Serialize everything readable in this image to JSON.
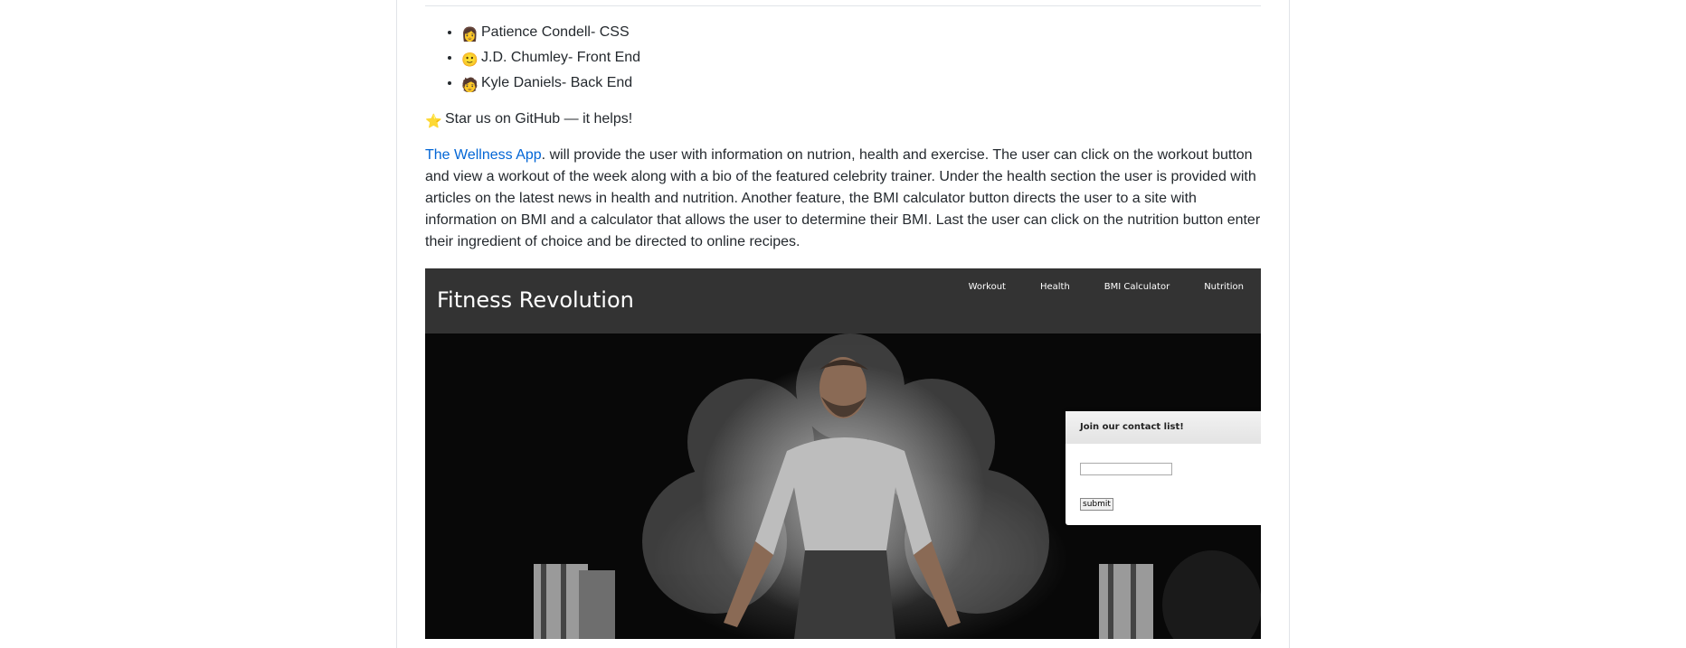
{
  "contributors": [
    {
      "icon": "woman-technologist-icon",
      "glyph": "👩",
      "name": "Patience Condell- CSS"
    },
    {
      "icon": "smiling-face-icon",
      "glyph": "🙂",
      "name": "J.D. Chumley- Front End"
    },
    {
      "icon": "technologist-icon",
      "glyph": "🧑",
      "name": "Kyle Daniels- Back End"
    }
  ],
  "star": {
    "icon": "star-icon",
    "glyph": "⭐",
    "text": "Star us on GitHub — it helps!"
  },
  "description": {
    "link_text": "The Wellness App",
    "body": ". will provide the user with information on nutrion, health and exercise. The user can click on the workout button and view a workout of the week along with a bio of the featured celebrity trainer. Under the health section the user is provided with articles on the latest news in health and nutrition. Another feature, the BMI calculator button directs the user to a site with information on BMI and a calculator that allows the user to determine their BMI. Last the user can click on the nutrition button enter their ingredient of choice and be directed to online recipes."
  },
  "screenshot": {
    "brand": "Fitness Revolution",
    "nav": [
      "Workout",
      "Health",
      "BMI Calculator",
      "Nutrition"
    ],
    "contact": {
      "title": "Join our contact list!",
      "input_value": "",
      "submit_label": "submit"
    },
    "colors": {
      "header_bg": "#333333",
      "hero_bg": "#080808",
      "link": "#0366d6"
    }
  }
}
